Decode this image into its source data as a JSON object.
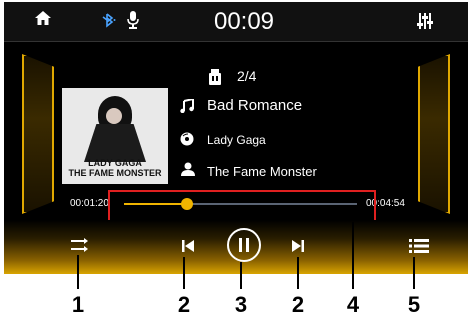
{
  "status_bar": {
    "clock": "00:09",
    "icons": [
      "home-icon",
      "bluetooth-icon",
      "microphone-icon",
      "equalizer-icon"
    ]
  },
  "album_art": {
    "line1": "LADY GAGA",
    "line2": "THE FAME MONSTER"
  },
  "track": {
    "position": "2/4",
    "title": "Bad Romance",
    "artist": "Lady Gaga",
    "album": "The Fame Monster"
  },
  "progress": {
    "elapsed": "00:01:20",
    "duration": "00:04:54",
    "fraction": 0.272
  },
  "controls": [
    "shuffle-icon",
    "previous-icon",
    "play-pause-icon",
    "next-icon",
    "playlist-icon"
  ],
  "callouts": [
    "1",
    "2",
    "3",
    "2",
    "4",
    "5"
  ],
  "colors": {
    "accent": "#f0b400",
    "callout_box": "#e02020",
    "background": "#000000"
  }
}
